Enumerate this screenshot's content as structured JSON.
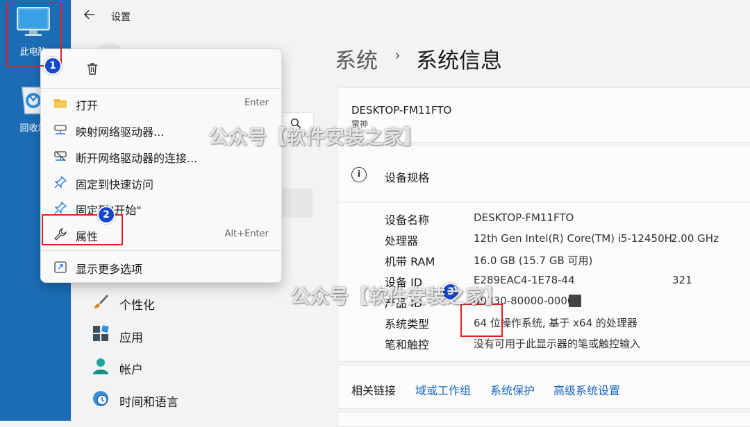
{
  "desktop": {
    "this_pc_label": "此电脑",
    "recycle_label": "回收站"
  },
  "window": {
    "title": "设置"
  },
  "breadcrumb": {
    "parent": "系统",
    "separator": "›",
    "current": "系统信息"
  },
  "device": {
    "name": "DESKTOP-FM11FTO",
    "model": "雷神"
  },
  "specs": {
    "header": "设备规格",
    "rows": [
      {
        "label": "设备名称",
        "value": "DESKTOP-FM11FTO",
        "extra": ""
      },
      {
        "label": "处理器",
        "value": "12th Gen Intel(R) Core(TM) i5-12450H",
        "extra": "2.00 GHz"
      },
      {
        "label": "机带 RAM",
        "value": "16.0 GB (15.7 GB 可用)",
        "extra": ""
      },
      {
        "label": "设备 ID",
        "value": "E289EAC4-1E78-44",
        "extra": "321"
      },
      {
        "label": "产品 ID",
        "value": "00330-80000-0000",
        "extra": ""
      },
      {
        "label": "系统类型",
        "value": "64 位操作系统, 基于 x64 的处理器",
        "extra": ""
      },
      {
        "label": "笔和触控",
        "value": "没有可用于此显示器的笔或触控输入",
        "extra": ""
      }
    ]
  },
  "related": {
    "title": "相关链接",
    "links": [
      "域或工作组",
      "系统保护",
      "高级系统设置"
    ]
  },
  "nav": {
    "items": [
      {
        "label": "个性化",
        "icon": "brush-icon"
      },
      {
        "label": "应用",
        "icon": "apps-icon"
      },
      {
        "label": "帐户",
        "icon": "account-icon"
      },
      {
        "label": "时间和语言",
        "icon": "clock-globe-icon"
      }
    ]
  },
  "context_menu": {
    "items": [
      {
        "label": "打开",
        "shortcut": "Enter",
        "icon": "folder-icon"
      },
      {
        "label": "映射网络驱动器...",
        "shortcut": "",
        "icon": "map-drive-icon"
      },
      {
        "label": "断开网络驱动器的连接...",
        "shortcut": "",
        "icon": "disconnect-drive-icon"
      },
      {
        "label": "固定到快速访问",
        "shortcut": "",
        "icon": "pin-icon"
      },
      {
        "label": "固定到\"开始\"",
        "shortcut": "",
        "icon": "pin-icon"
      },
      {
        "label": "属性",
        "shortcut": "Alt+Enter",
        "icon": "wrench-icon"
      },
      {
        "label": "显示更多选项",
        "shortcut": "",
        "icon": "more-options-icon"
      }
    ]
  },
  "annotations": {
    "step1": "1",
    "step2": "2",
    "step3": "3",
    "watermark": "公众号【软件安装之家】"
  },
  "colors": {
    "annotation_red": "#e02020",
    "step_blue": "#1447c9",
    "link_blue": "#1565c0",
    "desktop_blue": "#1c6db5"
  }
}
